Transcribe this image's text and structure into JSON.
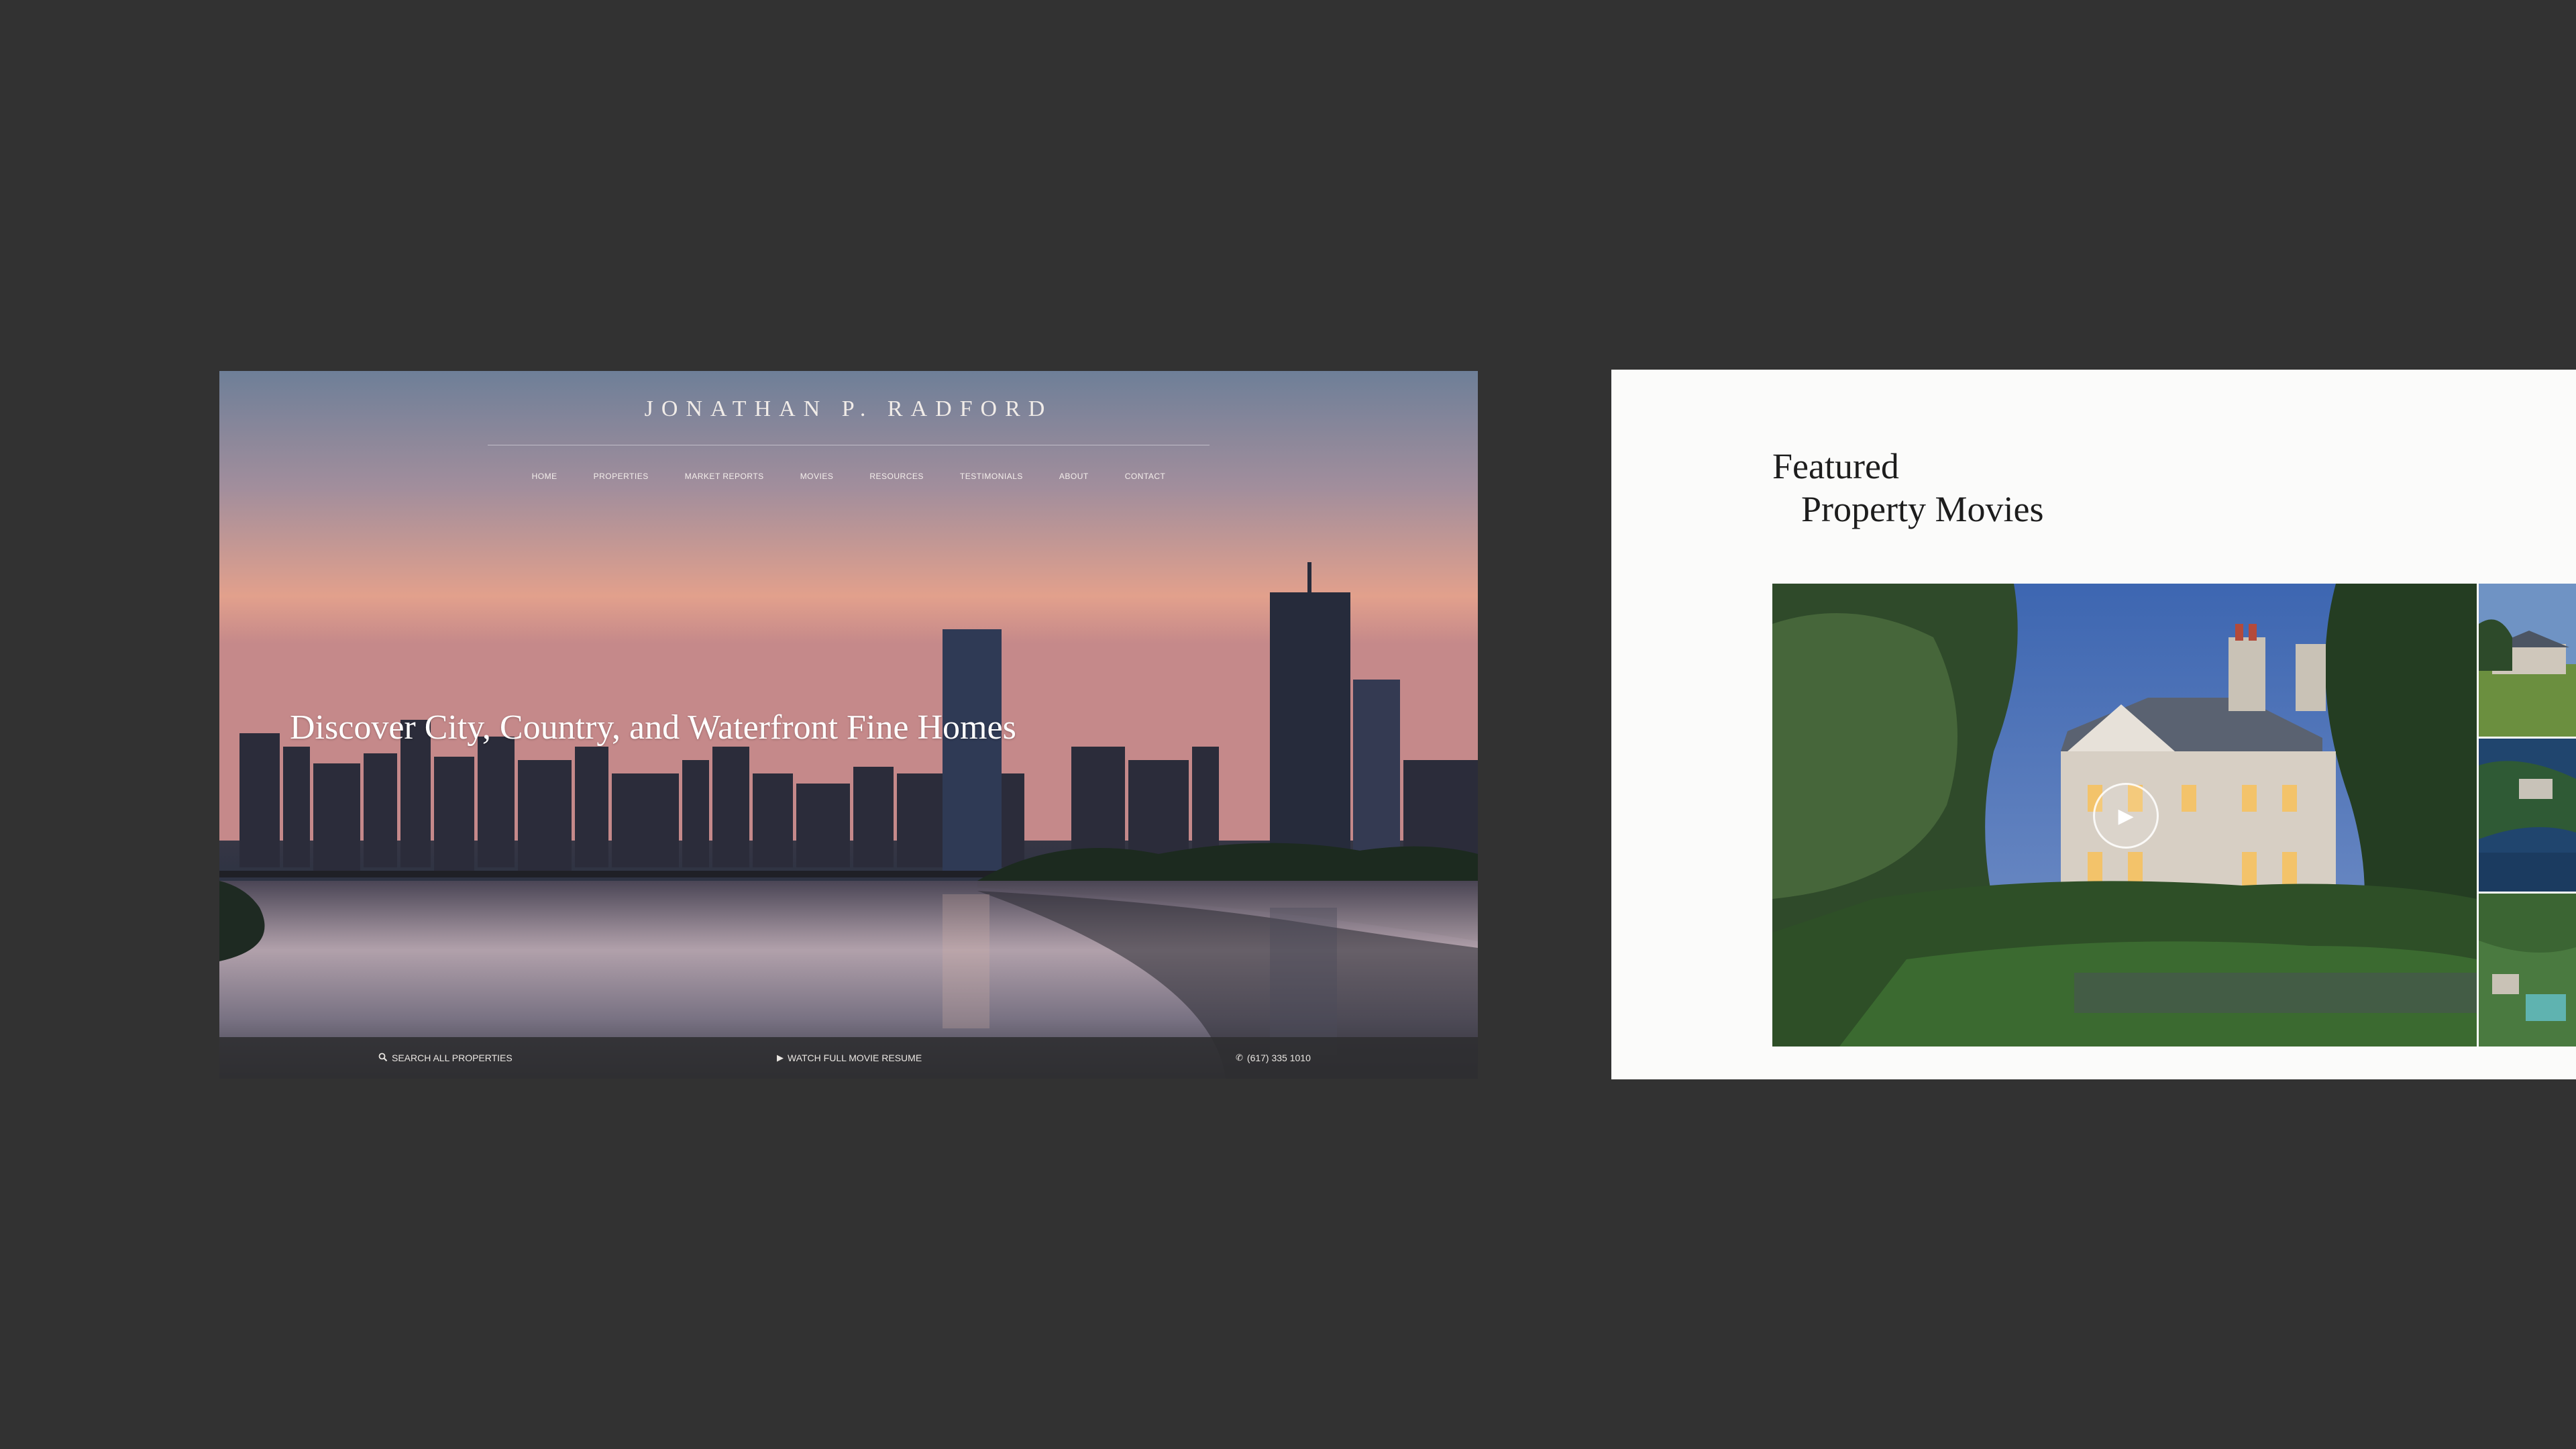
{
  "hero": {
    "brand": "JONATHAN P. RADFORD",
    "nav": [
      "HOME",
      "PROPERTIES",
      "MARKET REPORTS",
      "MOVIES",
      "RESOURCES",
      "TESTIMONIALS",
      "ABOUT",
      "CONTACT"
    ],
    "headline": "Discover City, Country, and Waterfront Fine Homes",
    "bar": {
      "search_label": "SEARCH ALL PROPERTIES",
      "movie_label": "WATCH FULL MOVIE RESUME",
      "phone_label": "(617) 335 1010"
    },
    "icons": {
      "search": "search-icon",
      "play": "play-icon",
      "phone": "phone-icon"
    }
  },
  "featured": {
    "title_line1": "Featured",
    "title_line2": "Property Movies",
    "play_icon": "play-icon",
    "thumbnails": [
      "thumbnail-1",
      "thumbnail-2",
      "thumbnail-3"
    ]
  },
  "colors": {
    "background": "#323232",
    "panel_white": "#fbfbfa",
    "bar": "#2d2d30"
  }
}
